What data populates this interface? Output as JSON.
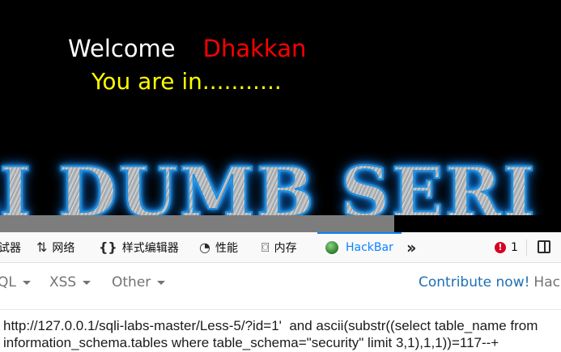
{
  "webpage": {
    "welcome": "Welcome",
    "username": "Dhakkan",
    "status": "You are in...........",
    "banner": "LI DUMB SERI",
    "colors": {
      "background": "#000000",
      "welcome": "#ffffff",
      "username": "#ff0000",
      "status": "#ffff00"
    }
  },
  "devtools": {
    "tabs": [
      {
        "label": "试器",
        "icon": ""
      },
      {
        "label": "网络",
        "icon": "network-arrows-icon"
      },
      {
        "label": "样式编辑器",
        "icon": "braces-icon"
      },
      {
        "label": "性能",
        "icon": "gauge-icon"
      },
      {
        "label": "内存",
        "icon": "memory-chip-icon"
      },
      {
        "label": "HackBar",
        "icon": "hackbar-logo-icon",
        "selected": true
      }
    ],
    "more_icon": "double-chevron-icon",
    "error_count": "1",
    "dock_icon": "dock-side-icon",
    "accent": "#0a84ff"
  },
  "hackbar": {
    "menu": [
      "QL",
      "XSS",
      "Other"
    ],
    "contribute_text": "Contribute now!",
    "brand_text": "HackB",
    "url_value": "http://127.0.0.1/sqli-labs-master/Less-5/?id=1'  and ascii(substr((select table_name from information_schema.tables where table_schema=\"security\" limit 3,1),1,1))=117--+"
  }
}
